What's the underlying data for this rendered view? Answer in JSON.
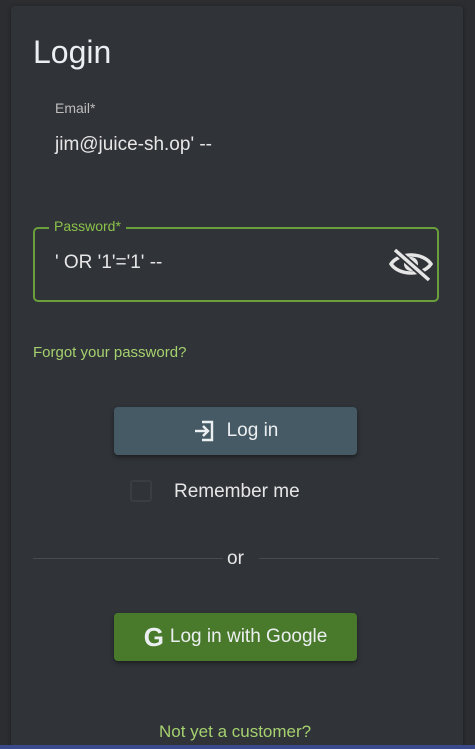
{
  "login": {
    "title": "Login",
    "email": {
      "label": "Email*",
      "value": "jim@juice-sh.op' --"
    },
    "password": {
      "label": "Password*",
      "value": "' OR '1'='1' --",
      "visibility_icon": "eye-off-icon"
    },
    "forgot_password": "Forgot your password?",
    "login_button": {
      "label": "Log in",
      "icon": "login-icon"
    },
    "remember_me": {
      "label": "Remember me",
      "checked": false
    },
    "divider_text": "or",
    "google_button": {
      "label": "Log in with Google",
      "icon": "G"
    },
    "register_link": "Not yet a customer?"
  },
  "colors": {
    "background": "#303338",
    "accent": "#8bc34a",
    "primary_button": "#455a64",
    "google_button": "#497a2b",
    "link": "#a5d16f"
  }
}
